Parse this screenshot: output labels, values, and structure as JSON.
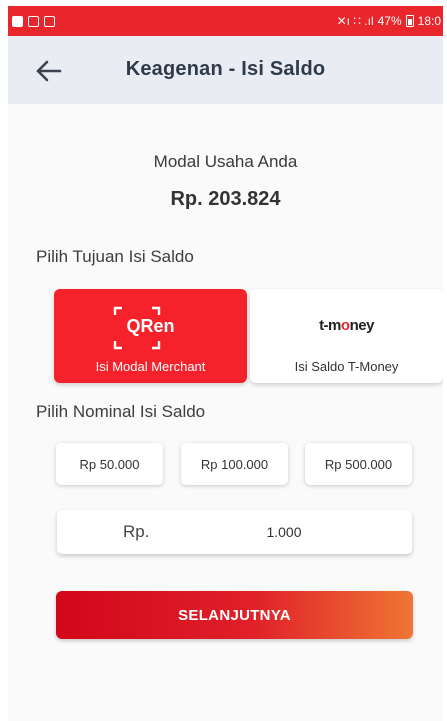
{
  "status_bar": {
    "signal_text": "✕ı ∷ .ıl",
    "battery_percent": "47%",
    "time": "18:0"
  },
  "app_bar": {
    "title": "Keagenan - Isi Saldo"
  },
  "balance": {
    "label": "Modal Usaha Anda",
    "value": "Rp. 203.824"
  },
  "destination": {
    "label": "Pilih Tujuan Isi Saldo",
    "options": [
      {
        "logo_text": "QRen",
        "caption": "Isi Modal Merchant",
        "selected": true
      },
      {
        "logo_text_left": "t-m",
        "logo_text_o": "o",
        "logo_text_right": "ney",
        "caption": "Isi Saldo T-Money",
        "selected": false
      }
    ]
  },
  "nominal": {
    "label": "Pilih Nominal Isi Saldo",
    "presets": [
      "Rp 50.000",
      "Rp 100.000",
      "Rp 500.000"
    ],
    "input_prefix": "Rp.",
    "input_value": "1.000"
  },
  "submit_label": "SELANJUTNYA",
  "colors": {
    "brand_red": "#e8262b",
    "appbar_bg": "#e9ecf2",
    "button_gradient_end": "#ef7533"
  }
}
